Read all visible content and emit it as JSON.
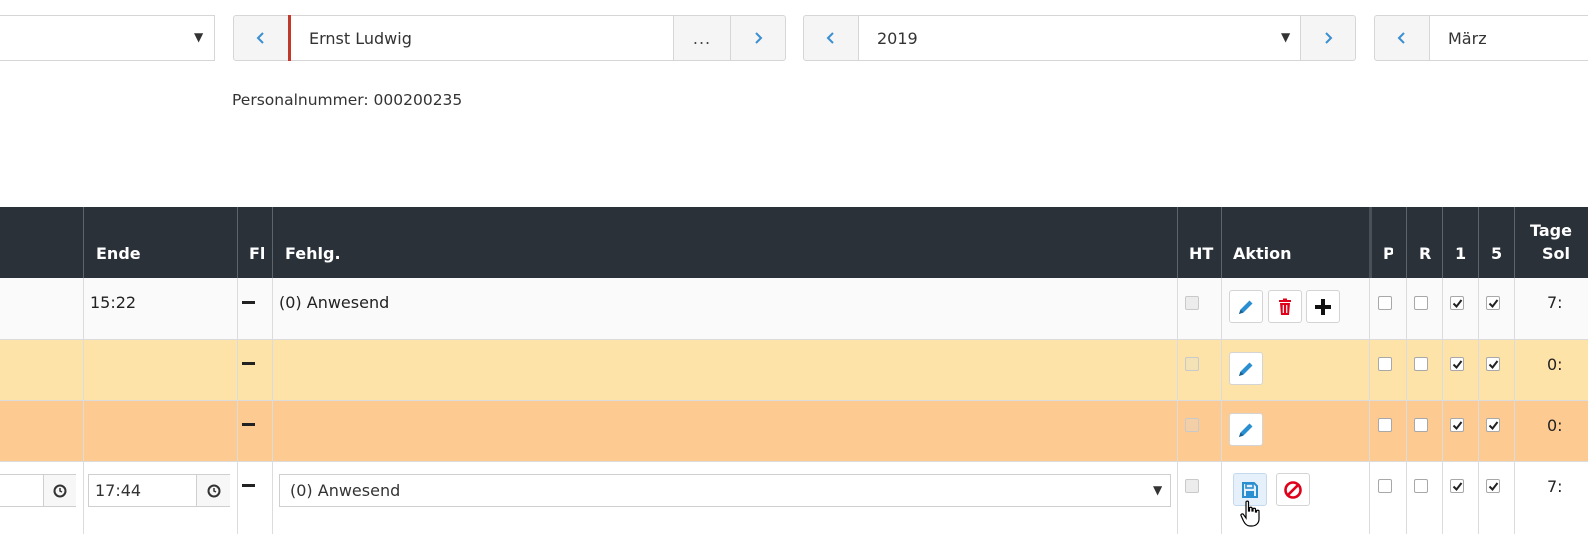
{
  "selectors": {
    "first_dropdown": {
      "value": ""
    },
    "employee": {
      "name": "Ernst Ludwig",
      "more_label": "..."
    },
    "year": {
      "value": "2019"
    },
    "month": {
      "value": "März"
    }
  },
  "employee_info": {
    "personalnummer_label": "Personalnummer: 000200235"
  },
  "table": {
    "headers": {
      "ende": "Ende",
      "fl": "Fl",
      "fehlg": "Fehlg.",
      "ht": "HT",
      "aktion": "Aktion",
      "p": "P",
      "r": "R",
      "c1": "1",
      "c5": "5",
      "tage_line1": "Tage",
      "tage_line2": "Sol"
    },
    "rows": [
      {
        "ende": "15:22",
        "fehlg": "(0) Anwesend",
        "tage": "7:",
        "status": "normal"
      },
      {
        "ende": "",
        "fehlg": "",
        "tage": "0:",
        "status": "yellow"
      },
      {
        "ende": "",
        "fehlg": "",
        "tage": "0:",
        "status": "orange"
      },
      {
        "ende": "17:44",
        "fehlg": "(0) Anwesend",
        "tage": "7:",
        "status": "editing"
      }
    ]
  },
  "colors": {
    "header_bg": "#2b3139",
    "accent_blue": "#3a8fd0",
    "delete_red": "#e0001a",
    "row_yellow": "#fde3a7",
    "row_orange": "#fdca92",
    "employee_marker": "#c0392b"
  },
  "icons": [
    "chevron-left-icon",
    "chevron-right-icon",
    "caret-down-icon",
    "pencil-icon",
    "trash-icon",
    "plus-icon",
    "save-icon",
    "cancel-icon",
    "clock-icon",
    "checkbox-check-icon",
    "hand-cursor-icon"
  ]
}
